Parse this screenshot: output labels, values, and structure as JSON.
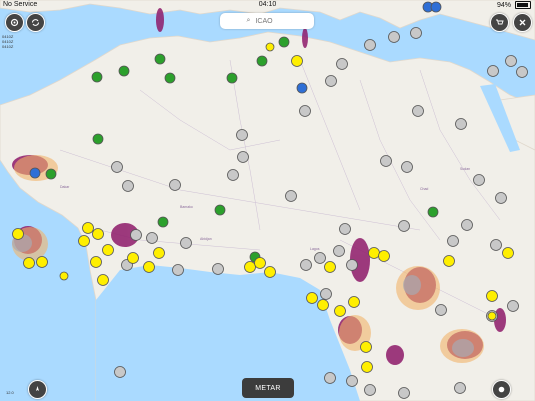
{
  "status": {
    "carrier": "No Service",
    "time": "04:10",
    "battery": "94%"
  },
  "search": {
    "placeholder": "ICAO"
  },
  "overlay_text": {
    "line1": "0410Z",
    "line2": "0410Z",
    "line3": "0410Z"
  },
  "bottom": {
    "metar_label": "METAR",
    "zoom_level": "12.0"
  },
  "colors": {
    "ocean": "#aadaff",
    "land": "#f1efe9",
    "vfr": "#2ca02c",
    "mvfr": "#2f6fd6",
    "no_data": "#c8c8c8",
    "yellow": "#ffef00"
  }
}
